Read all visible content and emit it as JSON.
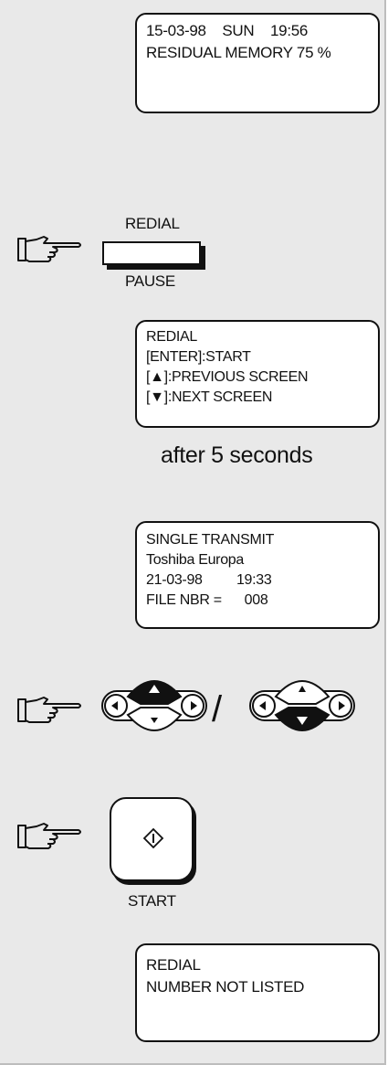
{
  "screen1": {
    "lines": [
      "15-03-98    SUN    19:56",
      "",
      "RESIDUAL MEMORY 75 %"
    ]
  },
  "redial_key": {
    "top_label": "REDIAL",
    "bottom_label": "PAUSE"
  },
  "screen2": {
    "lines": [
      "REDIAL",
      "[ENTER]:START",
      "[▲]:PREVIOUS SCREEN",
      "[▼]:NEXT SCREEN"
    ]
  },
  "delay_note": "after 5 seconds",
  "screen3": {
    "lines": [
      "SINGLE TRANSMIT",
      "Toshiba Europa",
      "21-03-98         19:33",
      "FILE NBR =      008"
    ]
  },
  "nav_separator": "/",
  "start_key": {
    "label": "START"
  },
  "screen4": {
    "lines": [
      "REDIAL",
      "",
      "NUMBER NOT LISTED"
    ]
  },
  "icons": [
    "pointing-hand-icon",
    "redial-pause-key",
    "up-down-navigation-key-icon",
    "start-diamond-icon"
  ],
  "colors": {
    "panel": "#e9e9e9",
    "ink": "#111111"
  }
}
